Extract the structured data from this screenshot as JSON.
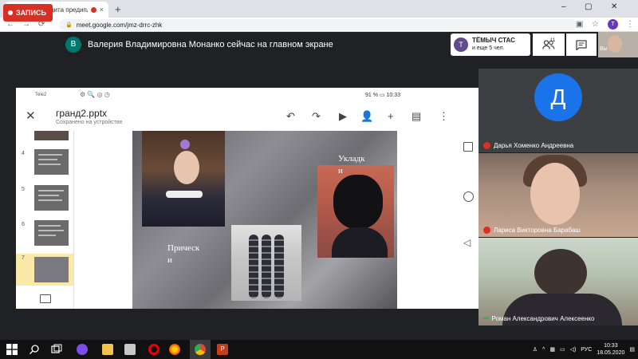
{
  "browser": {
    "tab_title": "Meet – Защита предиплом",
    "tab_close": "×",
    "new_tab": "+",
    "url": "meet.google.com/jmz-drrc-zhk",
    "profile_initial": "T",
    "controls": {
      "minimize": "–",
      "maximize": "▢",
      "close": "✕"
    }
  },
  "meet": {
    "record_label": "ЗАПИСЬ",
    "presenter_initial": "В",
    "presenter_text": "Валерия Владимировна Монанко сейчас на главном экране",
    "chat_notice": {
      "avatar": "T",
      "name": "ТЁМЫЧ СТАС",
      "more": "и еще 5 чел."
    },
    "people_count": "11",
    "self_label": "Вы"
  },
  "phone": {
    "carrier": "Tele2",
    "status_right": "91 %  ▭  10:33",
    "file_name": "гранд2.pptx",
    "saved_status": "Сохранено на устройстве",
    "thumb_numbers": [
      "4",
      "5",
      "6",
      "7"
    ],
    "slide_text": {
      "left_1": "Прическ",
      "left_2": "и",
      "right_1": "Укладк",
      "right_2": "и"
    }
  },
  "participants": [
    {
      "initial": "Д",
      "name": "Дарья Хоменко Андреевна",
      "muted": true
    },
    {
      "name": "Лариса Викторовна Барабаш",
      "muted": true
    },
    {
      "name": "Роман Александрович Алексеенко",
      "muted": false
    }
  ],
  "taskbar": {
    "lang": "РУС",
    "time": "10:33",
    "date": "18.05.2020"
  },
  "colors": {
    "meet_bg": "#202124",
    "record_red": "#d93025",
    "avatar_blue": "#1a73e8"
  }
}
